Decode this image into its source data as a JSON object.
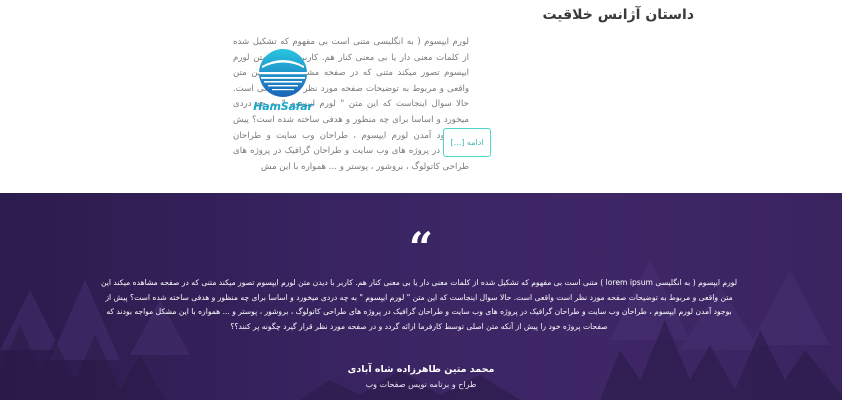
{
  "agency": {
    "title": "داستان آژانس خلاقیت",
    "description": "لورم ایپسوم ( به انگلیسی متنی است بی مفهوم که تشکیل شده از کلمات معنی دار یا بی معنی کنار هم. کاربر با دیدن متن لورم ایپسوم تصور میکند متنی که در صفحه مشاهده میکند این متن واقعی و مربوط به توضیحات صفحه مورد نظر است واقعی است. حالا سوال اینجاست که این متن \" لورم ایپسوم \" به چه دردی میخورد و اساسا برای چه منظور و هدفی ساخته شده است؟ پیش از بوجود آمدن لورم ایپسوم ، طراحان وب سایت و طراحان گرافیک در پروژه های وب سایت و طراحان گرافیک در پروژه های طراحی کاتولوگ ، بروشور ، پوستر و ... همواره با این مش",
    "more_label": "ادامه [...]"
  },
  "logo": {
    "brand_text": "HamSafar"
  },
  "testimonial": {
    "quote_mark": "“",
    "quote": "لورم ایپسوم ( به انگلیسی lorem ipsum ) متنی است بی مفهوم که تشکیل شده از کلمات معنی دار یا بی معنی کنار هم. کاربر با دیدن متن لورم ایپسوم تصور میکند متنی که در صفحه مشاهده میکند این متن واقعی و مربوط به توضیحات صفحه مورد نظر است واقعی است. حالا سوال اینجاست که این متن \" لورم ایپسوم \" به چه دردی میخورد و اساسا برای چه منظور و هدفی ساخته شده است؟ پیش از بوجود آمدن لورم ایپسوم ، طراحان وب سایت و طراحان گرافیک در پروژه های وب سایت و طراحان گرافیک در پروژه های طراحی کاتولوگ ، بروشور ، پوستر و ... همواره با این مشکل مواجه بودند که صفحات پروژه خود را پیش از آنکه متن اصلی توسط کارفرما ارائه گردد و در صفحه مورد نظر قرار گیرد چگونه پر کنند؟؟",
    "author_name": "محمد متین طاهرزاده شاه آبادی",
    "author_role": "طراح و برنامه نویس صفحات وب"
  },
  "colors": {
    "accent": "#4dd6c6",
    "logo_blue": "#1aa6ca",
    "testimonial_bg": "#3a2563"
  }
}
